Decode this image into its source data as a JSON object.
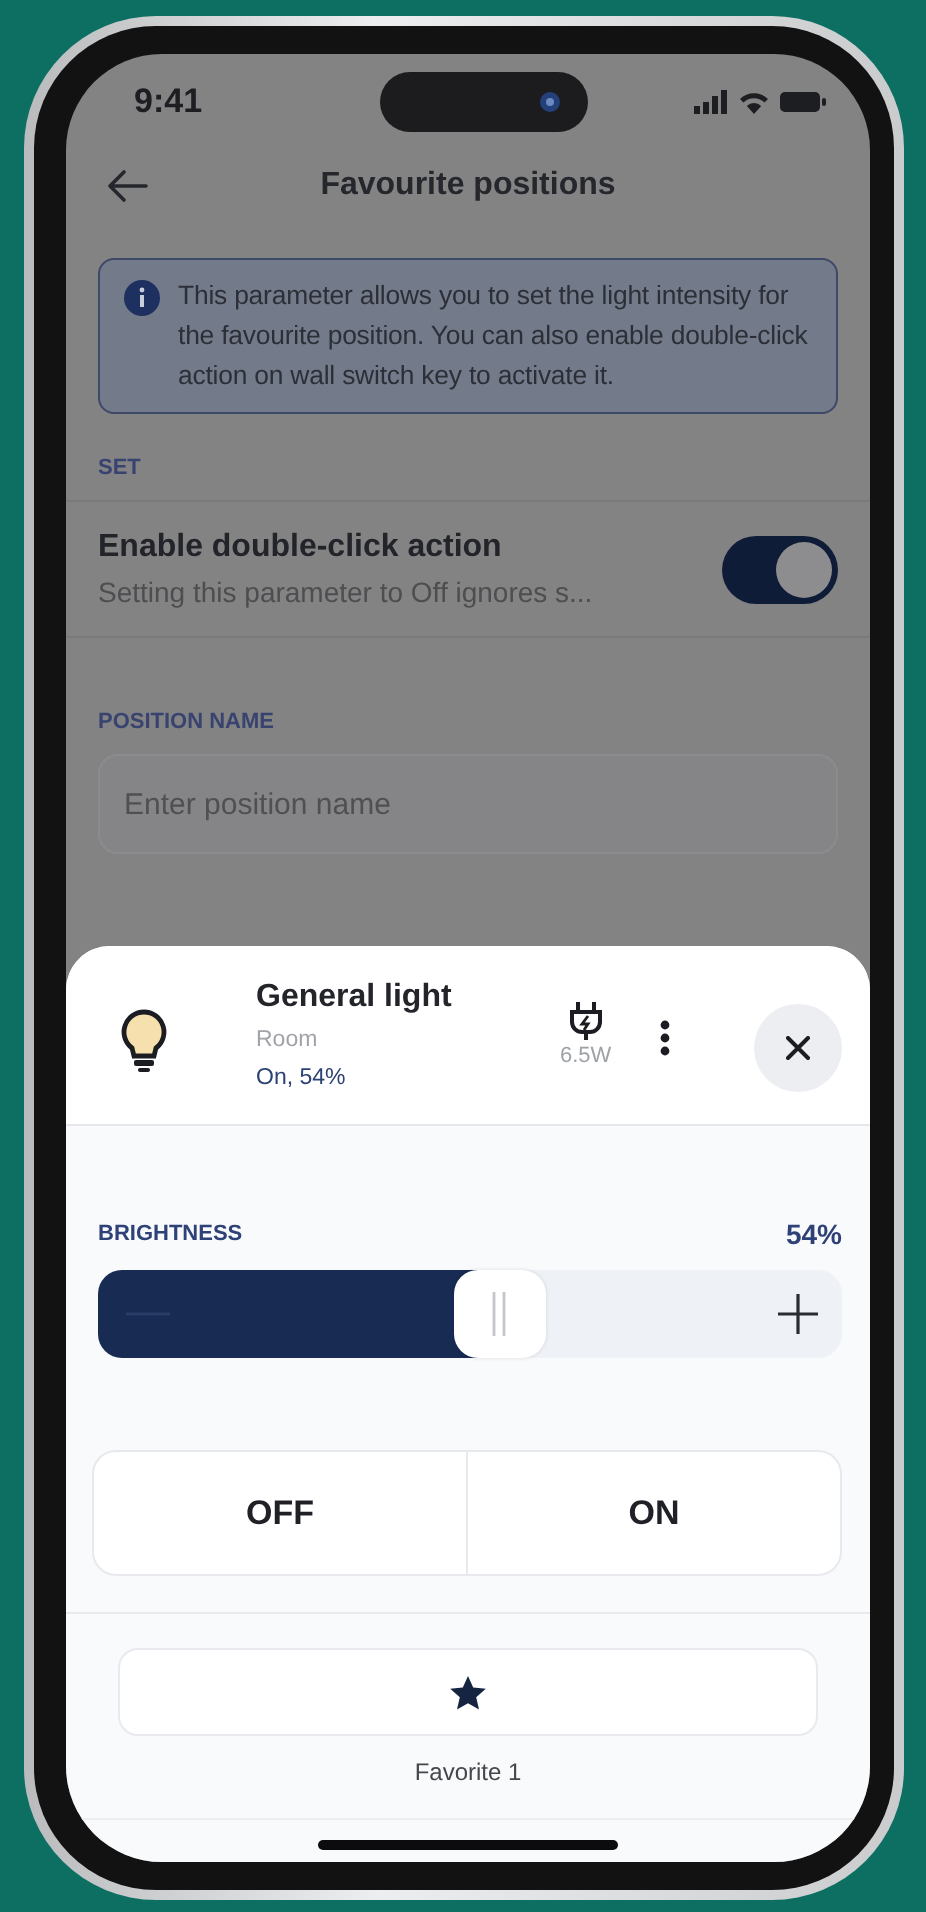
{
  "status_bar": {
    "time": "9:41"
  },
  "header": {
    "title": "Favourite positions"
  },
  "info_box": {
    "text": "This parameter allows you to set the light intensity for the favourite position. You can also enable double-click action on wall switch key to activate it."
  },
  "set_section": {
    "label": "SET",
    "setting": {
      "title": "Enable double-click action",
      "subtitle": "Setting this parameter to Off ignores s...",
      "on": true
    }
  },
  "position_name": {
    "label": "POSITION NAME",
    "placeholder": "Enter position name"
  },
  "sheet": {
    "device": {
      "name": "General light",
      "room": "Room",
      "state": "On, 54%",
      "power": "6.5W"
    },
    "brightness": {
      "label": "BRIGHTNESS",
      "reading": "54%",
      "level": 0.54
    },
    "buttons": [
      {
        "label": "OFF"
      },
      {
        "label": "ON"
      }
    ],
    "favorite": {
      "label": "Favorite 1"
    }
  }
}
